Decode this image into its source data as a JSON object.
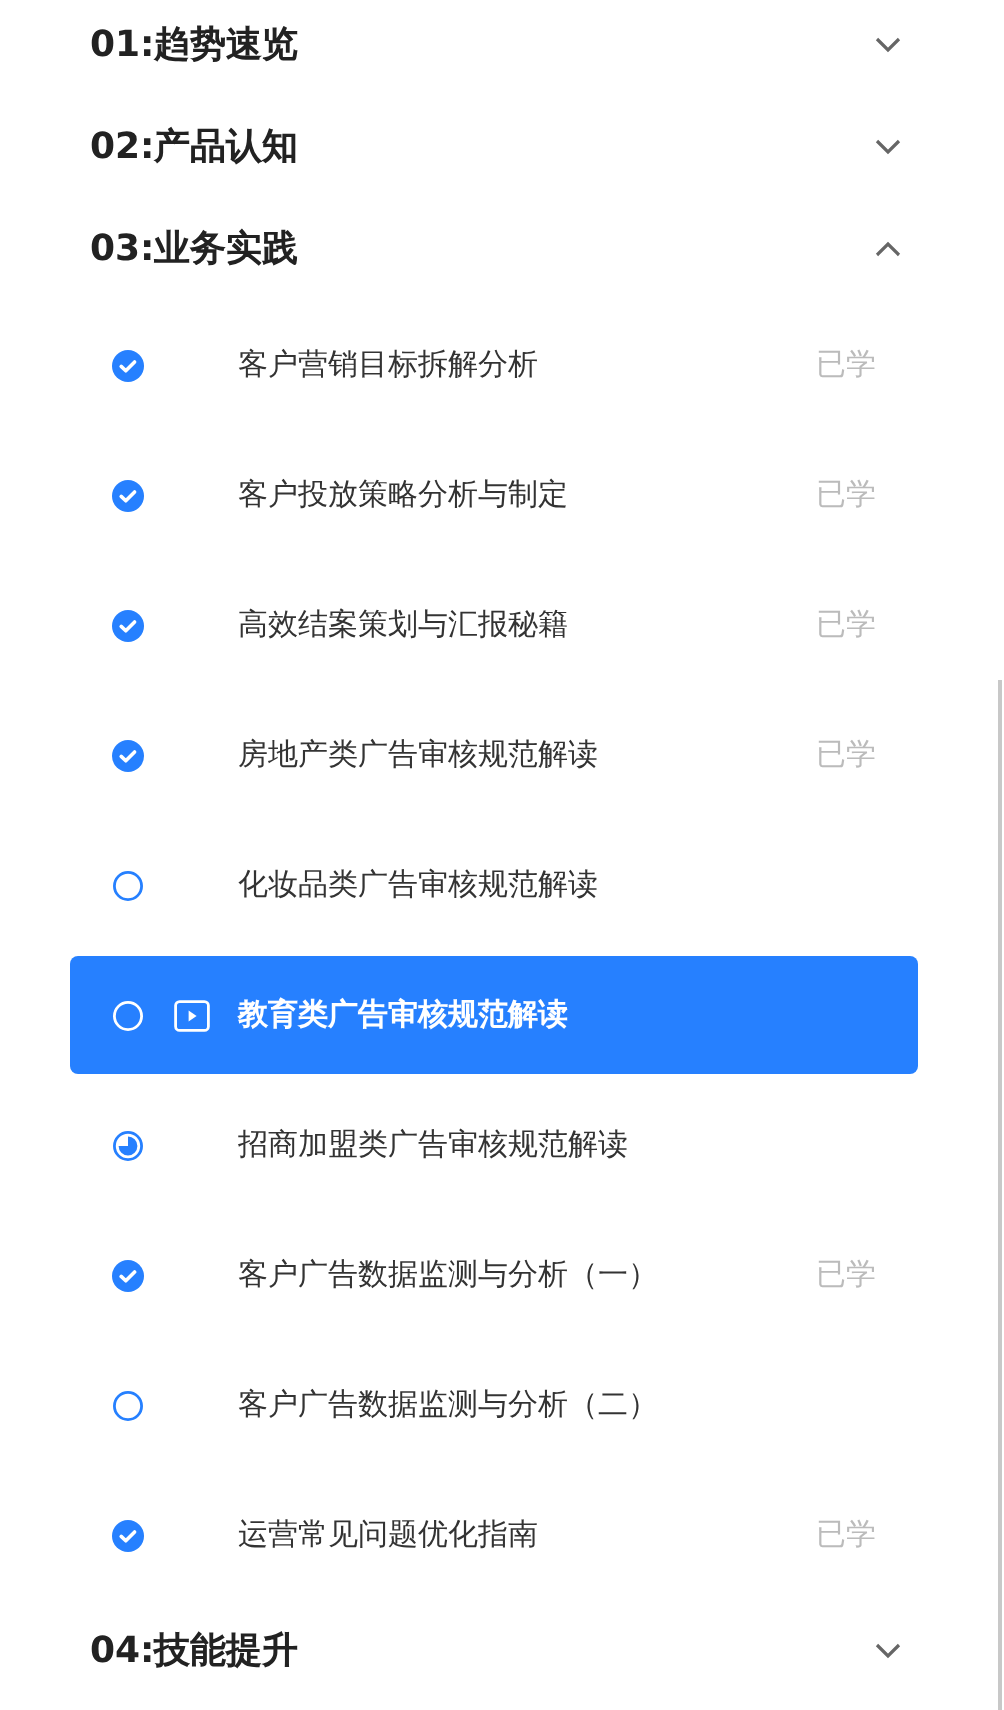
{
  "sections": [
    {
      "title": "01:趋势速览",
      "expanded": false
    },
    {
      "title": "02:产品认知",
      "expanded": false
    },
    {
      "title": "03:业务实践",
      "expanded": true,
      "lessons": [
        {
          "title": "客户营销目标拆解分析",
          "kind": "done",
          "label": "已学",
          "selected": false
        },
        {
          "title": "客户投放策略分析与制定",
          "kind": "done",
          "label": "已学",
          "selected": false
        },
        {
          "title": "高效结案策划与汇报秘籍",
          "kind": "done",
          "label": "已学",
          "selected": false
        },
        {
          "title": "房地产类广告审核规范解读",
          "kind": "done",
          "label": "已学",
          "selected": false
        },
        {
          "title": "化妆品类广告审核规范解读",
          "kind": "todo",
          "selected": false
        },
        {
          "title": "教育类广告审核规范解读",
          "kind": "todo",
          "selected": true
        },
        {
          "title": "招商加盟类广告审核规范解读",
          "kind": "partial",
          "selected": false
        },
        {
          "title": "客户广告数据监测与分析（一）",
          "kind": "done",
          "label": "已学",
          "selected": false
        },
        {
          "title": "客户广告数据监测与分析（二）",
          "kind": "todo",
          "selected": false
        },
        {
          "title": "运营常见问题优化指南",
          "kind": "done",
          "label": "已学",
          "selected": false
        }
      ]
    },
    {
      "title": "04:技能提升",
      "expanded": false
    }
  ]
}
